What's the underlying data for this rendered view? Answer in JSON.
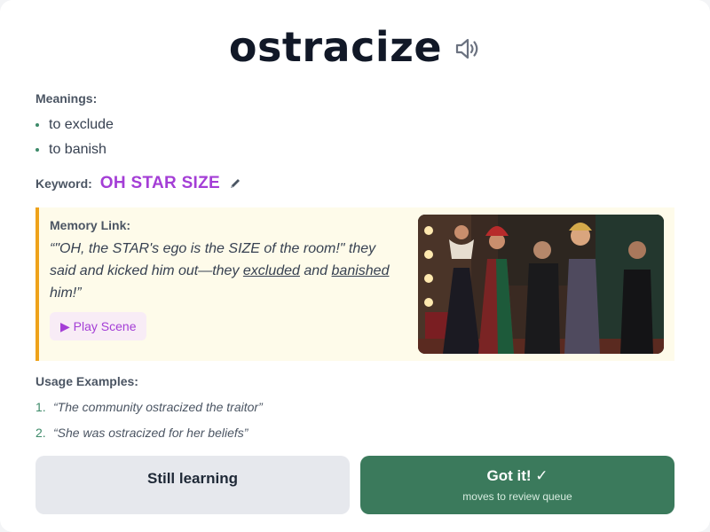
{
  "word": "ostracize",
  "meanings_label": "Meanings:",
  "meanings": [
    "to exclude",
    "to banish"
  ],
  "keyword": {
    "label": "Keyword:",
    "value": "OH STAR SIZE"
  },
  "memory": {
    "label": "Memory Link:",
    "text_parts": [
      "“\"OH, the STAR's ego is the SIZE of the room!\" they said and kicked him out—they ",
      "excluded",
      " and ",
      "banished",
      " him!”"
    ],
    "play_label": "▶ Play Scene"
  },
  "usage": {
    "label": "Usage Examples:",
    "items": [
      {
        "num": "1.",
        "text": "“The community ostracized the traitor”"
      },
      {
        "num": "2.",
        "text": "“She was ostracized for her beliefs”"
      }
    ]
  },
  "buttons": {
    "still_learning": "Still learning",
    "got_it": "Got it! ✓",
    "got_it_sub": "moves to review queue"
  },
  "icons": {
    "speaker": "speaker-icon",
    "pencil": "pencil-icon"
  },
  "colors": {
    "accent": "#a43ed6",
    "green": "#3b7a5c",
    "memory_border": "#eea21a",
    "memory_bg": "#fefbea"
  }
}
